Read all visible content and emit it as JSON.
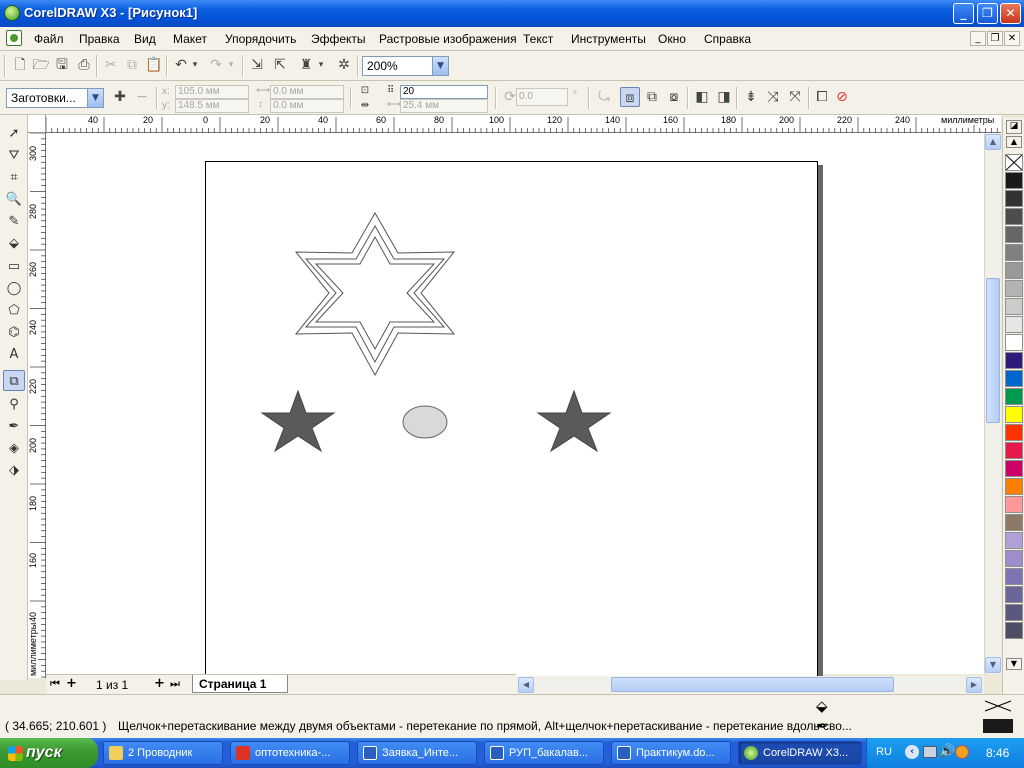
{
  "titlebar": {
    "title": "CorelDRAW X3 - [Рисунок1]",
    "minimize": "_",
    "maximize": "❐",
    "close": "✕"
  },
  "menubar": {
    "items": [
      "Файл",
      "Правка",
      "Вид",
      "Макет",
      "Упорядочить",
      "Эффекты",
      "Растровые изображения",
      "Текст",
      "Инструменты",
      "Окно",
      "Справка"
    ],
    "mdi_min": "_",
    "mdi_restore": "❐",
    "mdi_close": "✕"
  },
  "toolbar1": {
    "zoom": "200%"
  },
  "toolbar2": {
    "preset": "Заготовки...",
    "x_label": "x:",
    "x_value": "105.0 мм",
    "y_label": "y:",
    "y_value": "148.5 мм",
    "w_value": "0.0 мм",
    "h_value": "0.0 мм",
    "steps_value": "20",
    "offset_value": "25.4 мм",
    "angle_value": "0.0",
    "degree": "°"
  },
  "ruler": {
    "unit": "миллиметры",
    "top_labels": [
      "40",
      "20",
      "0",
      "20",
      "40",
      "60",
      "80",
      "100",
      "120",
      "140",
      "160",
      "180",
      "200",
      "220",
      "240"
    ],
    "left_labels": [
      "300",
      "280",
      "260",
      "240",
      "220",
      "200",
      "180",
      "160",
      "140"
    ]
  },
  "pages": {
    "counter": "1 из 1",
    "tab": "Страница 1"
  },
  "status": {
    "coords": "( 34.665; 210.601 )",
    "hint": "Щелчок+перетаскивание между двумя объектами - перетекание по прямой, Alt+щелчок+перетаскивание - перетекание вдоль сво..."
  },
  "palette": {
    "colors": [
      "#1a1a1a",
      "#333333",
      "#4d4d4d",
      "#666666",
      "#808080",
      "#999999",
      "#b3b3b3",
      "#cccccc",
      "#e6e6e6",
      "#ffffff",
      "#2e1a7a",
      "#0066cc",
      "#00994d",
      "#ffff00",
      "#ff3300",
      "#e6194b",
      "#cc0066",
      "#ff8000",
      "#ff9999",
      "#8c7a66",
      "#b3a0d9",
      "#9e8ccc",
      "#8073b3",
      "#6b6699",
      "#595980",
      "#4d4d66"
    ]
  },
  "taskbar": {
    "start": "пуск",
    "tasks": [
      "2 Проводник",
      "оптотехника-...",
      "Заявка_Инте...",
      "РУП_бакалав...",
      "Практикум.do...",
      "CorelDRAW X3..."
    ],
    "lang": "RU",
    "clock": "8:46"
  }
}
